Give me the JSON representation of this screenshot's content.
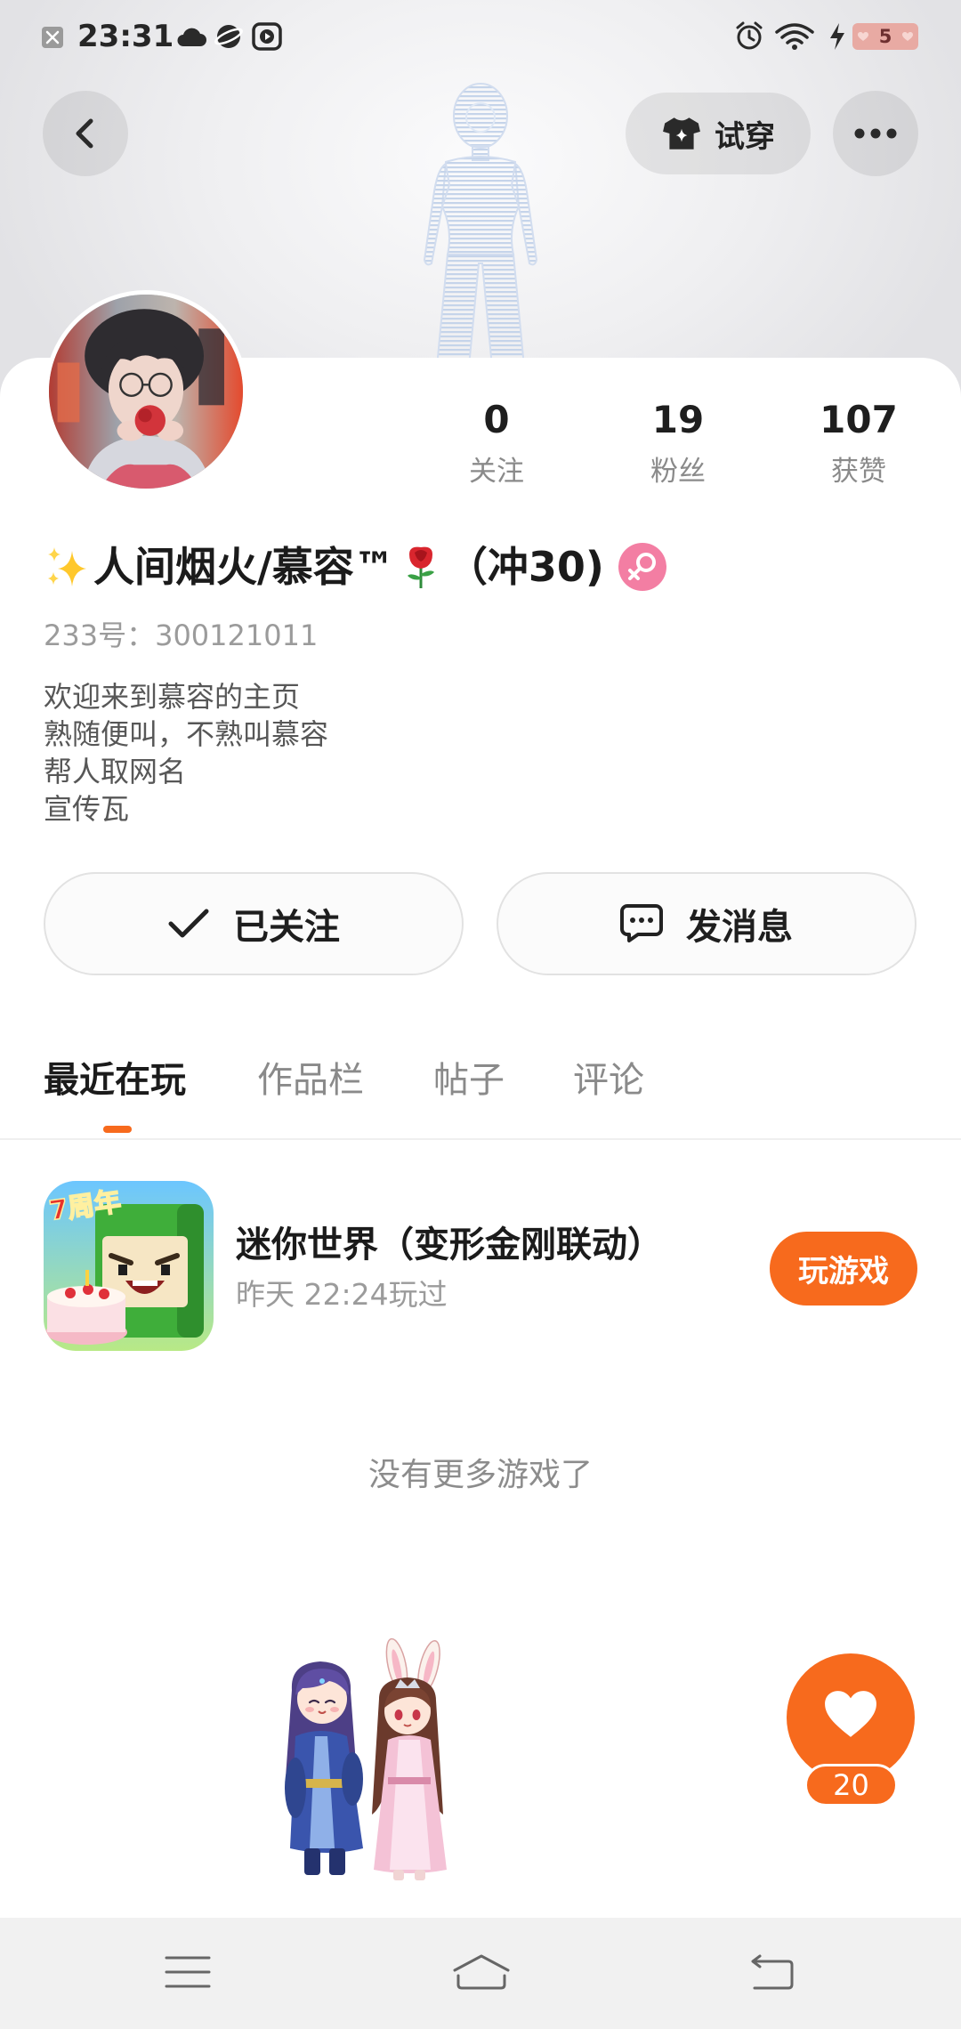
{
  "status_bar": {
    "time": "23:31",
    "battery_level": "5",
    "left_icons": [
      "notification-icon",
      "cloud-icon",
      "planet-icon",
      "media-icon"
    ],
    "right_icons": [
      "alarm-icon",
      "wifi-icon",
      "charging-icon",
      "battery-icon"
    ]
  },
  "header": {
    "try_on_label": "试穿",
    "icons": [
      "chevron-left-icon",
      "shirt-icon",
      "more-icon"
    ]
  },
  "profile": {
    "name_prefix_icon": "sparkles-icon",
    "name": "人间烟火/慕容™",
    "name_icon": "rose-icon",
    "name_suffix": "（冲30)",
    "gender_icon": "female-icon",
    "id_text": "233号：300121011",
    "bio": [
      "欢迎来到慕容的主页",
      "熟随便叫，不熟叫慕容",
      "帮人取网名",
      "宣传瓦"
    ],
    "stats": [
      {
        "value": "0",
        "label": "关注"
      },
      {
        "value": "19",
        "label": "粉丝"
      },
      {
        "value": "107",
        "label": "获赞"
      }
    ]
  },
  "actions": {
    "follow_label": "已关注",
    "message_label": "发消息"
  },
  "tabs": [
    {
      "label": "最近在玩",
      "active": true
    },
    {
      "label": "作品栏",
      "active": false
    },
    {
      "label": "帖子",
      "active": false
    },
    {
      "label": "评论",
      "active": false
    }
  ],
  "games": [
    {
      "title": "迷你世界（变形金刚联动）",
      "last_played": "昨天 22:24玩过",
      "play_label": "玩游戏",
      "icon_badge": "7周年"
    }
  ],
  "empty_text": "没有更多游戏了",
  "like_fab": {
    "count": "20",
    "icon": "heart-icon"
  },
  "nav_bar": {
    "icons": [
      "menu-icon",
      "home-icon",
      "back-icon"
    ]
  },
  "colors": {
    "accent": "#f76a1d",
    "gender_badge": "#f37ea3"
  }
}
